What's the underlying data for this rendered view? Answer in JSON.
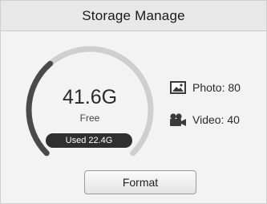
{
  "header": {
    "title": "Storage Manage"
  },
  "storage": {
    "free_value": "41.6G",
    "free_label": "Free",
    "used_label": "Used 22.4G",
    "used_fraction": 0.35
  },
  "stats": {
    "photo": {
      "label": "Photo: 80",
      "icon": "image-icon"
    },
    "video": {
      "label": "Video: 40",
      "icon": "video-camera-icon"
    }
  },
  "actions": {
    "format_label": "Format"
  },
  "colors": {
    "gauge_used": "#4a4a4a",
    "gauge_free": "#cfcfcf",
    "accent_dark": "#2f2f2f"
  }
}
